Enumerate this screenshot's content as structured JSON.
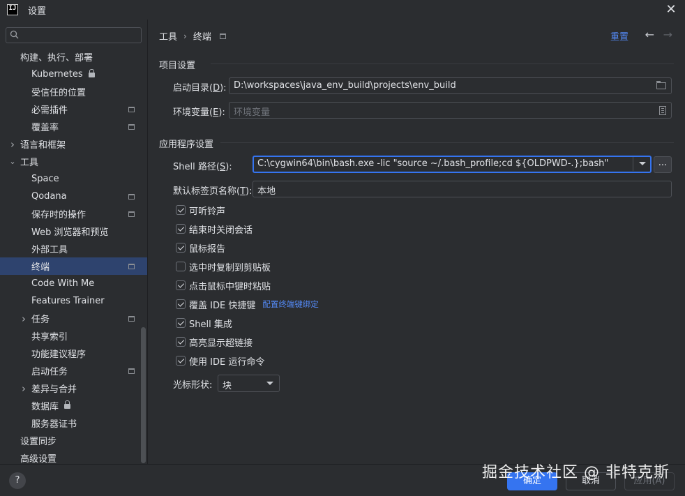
{
  "window": {
    "logo_text": "IJ",
    "title": "设置"
  },
  "search": {
    "placeholder": "",
    "value": ""
  },
  "sidebar": {
    "items": [
      {
        "label": "构建、执行、部署",
        "expander": "",
        "project": false,
        "lock": false,
        "selected": false
      },
      {
        "label": "Kubernetes",
        "expander": "",
        "project": false,
        "lock": true,
        "selected": false
      },
      {
        "label": "受信任的位置",
        "expander": "",
        "project": false,
        "lock": false,
        "selected": false
      },
      {
        "label": "必需插件",
        "expander": "",
        "project": true,
        "lock": false,
        "selected": false
      },
      {
        "label": "覆盖率",
        "expander": "",
        "project": true,
        "lock": false,
        "selected": false
      },
      {
        "label": "语言和框架",
        "expander": "collapsed",
        "project": false,
        "lock": false,
        "selected": false
      },
      {
        "label": "工具",
        "expander": "expanded",
        "project": false,
        "lock": false,
        "selected": false
      },
      {
        "label": "Space",
        "expander": "",
        "project": false,
        "lock": false,
        "selected": false
      },
      {
        "label": "Qodana",
        "expander": "",
        "project": true,
        "lock": false,
        "selected": false
      },
      {
        "label": "保存时的操作",
        "expander": "",
        "project": true,
        "lock": false,
        "selected": false
      },
      {
        "label": "Web 浏览器和预览",
        "expander": "",
        "project": false,
        "lock": false,
        "selected": false
      },
      {
        "label": "外部工具",
        "expander": "",
        "project": false,
        "lock": false,
        "selected": false
      },
      {
        "label": "终端",
        "expander": "",
        "project": true,
        "lock": false,
        "selected": true
      },
      {
        "label": "Code With Me",
        "expander": "",
        "project": false,
        "lock": false,
        "selected": false
      },
      {
        "label": "Features Trainer",
        "expander": "",
        "project": false,
        "lock": false,
        "selected": false
      },
      {
        "label": "任务",
        "expander": "collapsed",
        "project": true,
        "lock": false,
        "selected": false
      },
      {
        "label": "共享索引",
        "expander": "",
        "project": false,
        "lock": false,
        "selected": false
      },
      {
        "label": "功能建议程序",
        "expander": "",
        "project": false,
        "lock": false,
        "selected": false
      },
      {
        "label": "启动任务",
        "expander": "",
        "project": true,
        "lock": false,
        "selected": false
      },
      {
        "label": "差异与合并",
        "expander": "collapsed",
        "project": false,
        "lock": false,
        "selected": false
      },
      {
        "label": "数据库",
        "expander": "",
        "project": false,
        "lock": true,
        "selected": false
      },
      {
        "label": "服务器证书",
        "expander": "",
        "project": false,
        "lock": false,
        "selected": false
      },
      {
        "label": "设置同步",
        "expander": "",
        "project": false,
        "lock": false,
        "selected": false
      },
      {
        "label": "高级设置",
        "expander": "",
        "project": false,
        "lock": false,
        "selected": false
      }
    ]
  },
  "breadcrumb": {
    "parent": "工具",
    "separator": "›",
    "current": "终端"
  },
  "header": {
    "reset_label": "重置",
    "back_icon": "←",
    "forward_icon": "→"
  },
  "project_section": {
    "title": "项目设置",
    "start_dir": {
      "label": "启动目录",
      "mnemonic": "D",
      "value": "D:\\workspaces\\java_env_build\\projects\\env_build"
    },
    "env_vars": {
      "label": "环境变量",
      "mnemonic": "E",
      "placeholder": "环境变量"
    }
  },
  "app_section": {
    "title": "应用程序设置",
    "shell_path": {
      "label": "Shell 路径",
      "mnemonic": "S",
      "value": "C:\\cygwin64\\bin\\bash.exe -lic \"source ~/.bash_profile;cd ${OLDPWD-.};bash\""
    },
    "more_button_label": "...",
    "tab_name": {
      "label": "默认标签页名称",
      "mnemonic": "T",
      "value": "本地"
    },
    "checkboxes": [
      {
        "label": "可听铃声",
        "checked": true,
        "link": ""
      },
      {
        "label": "结束时关闭会话",
        "checked": true,
        "link": ""
      },
      {
        "label": "鼠标报告",
        "checked": true,
        "link": ""
      },
      {
        "label": "选中时复制到剪贴板",
        "checked": false,
        "link": ""
      },
      {
        "label": "点击鼠标中键时粘贴",
        "checked": true,
        "link": ""
      },
      {
        "label": "覆盖 IDE 快捷键",
        "checked": true,
        "link": "配置终端键绑定"
      },
      {
        "label": "Shell 集成",
        "checked": true,
        "link": ""
      },
      {
        "label": "高亮显示超链接",
        "checked": true,
        "link": ""
      },
      {
        "label": "使用 IDE 运行命令",
        "checked": true,
        "link": ""
      }
    ],
    "cursor_shape": {
      "label": "光标形状:",
      "value": "块"
    }
  },
  "footer": {
    "help_label": "?",
    "ok_label": "确定",
    "cancel_label": "取消",
    "apply_label": "应用(A)"
  },
  "watermark": "掘金技术社区 @ 非特克斯",
  "colors": {
    "background": "#2b2d30",
    "selection": "#2e436e",
    "accent": "#3574f0",
    "link": "#548af7"
  }
}
